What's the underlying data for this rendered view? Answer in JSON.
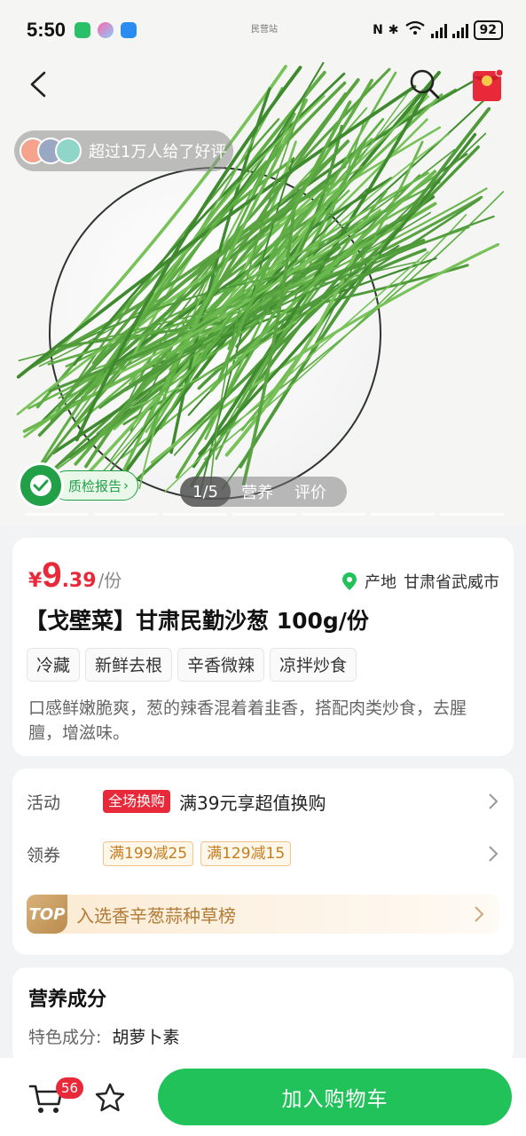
{
  "status_bar": {
    "time": "5:50",
    "center_label": "民营站",
    "battery": "92"
  },
  "hero": {
    "review_text": "超过1万人给了好评",
    "quality_report": "质检报告",
    "image_tabs": {
      "counter": "1/5",
      "nutrition": "营养",
      "reviews": "评价"
    }
  },
  "product": {
    "currency": "¥",
    "price_int": "9",
    "price_dec": ".39",
    "price_unit": "/份",
    "origin_label": "产地",
    "origin_value": "甘肃省武威市",
    "title": "【戈壁菜】甘肃民勤沙葱 100g/份",
    "tags": [
      "冷藏",
      "新鲜去根",
      "辛香微辣",
      "凉拌炒食"
    ],
    "description": "口感鲜嫩脆爽，葱的辣香混着着韭香，搭配肉类炒食，去腥膻，增滋味。"
  },
  "promo": {
    "activity_label": "活动",
    "activity_badge": "全场换购",
    "activity_text": "满39元享超值换购",
    "coupon_label": "领券",
    "coupons": [
      "满199减25",
      "满129减15"
    ],
    "top_badge": "TOP",
    "top_text": "入选香辛葱蒜种草榜"
  },
  "nutrition": {
    "title": "营养成分",
    "feature_label": "特色成分:",
    "feature_value": "胡萝卜素"
  },
  "bottom": {
    "cart_count": "56",
    "add_to_cart": "加入购物车"
  },
  "colors": {
    "accent_green": "#21c25a",
    "price_red": "#e8293a",
    "coupon_orange": "#c47d1e"
  }
}
